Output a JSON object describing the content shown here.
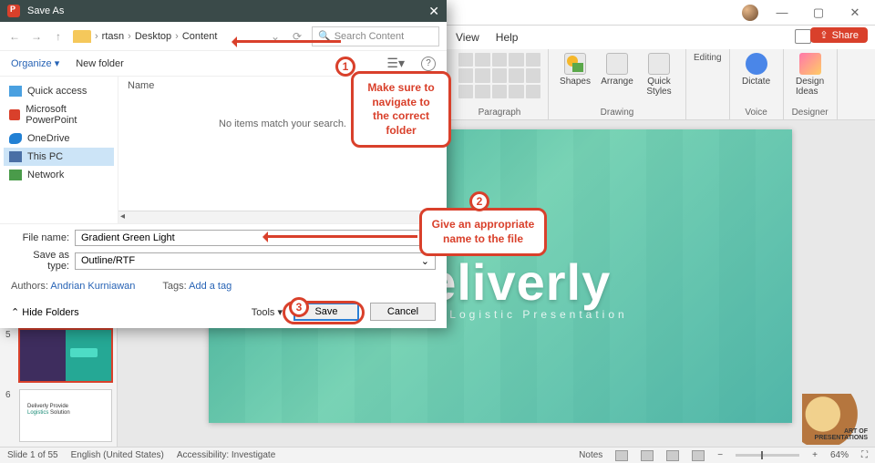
{
  "titlebar": {
    "min": "—",
    "max": "▢",
    "close": "✕"
  },
  "menubar": {
    "view": "View",
    "help": "Help",
    "share": "Share"
  },
  "ribbon": {
    "paragraph": "Paragraph",
    "drawing": "Drawing",
    "shapes": "Shapes",
    "arrange": "Arrange",
    "quick": "Quick",
    "styles": "Styles",
    "editing": "Editing",
    "voice": "Voice",
    "dictate": "Dictate",
    "designer": "Designer",
    "designideas": "Design\nIdeas"
  },
  "thumbs": {
    "n5": "5",
    "n6": "6",
    "t2a": "Deliverly Provide",
    "t2b": "Logistics",
    "t2c": " Solution"
  },
  "slide": {
    "title": "Deliverly",
    "sub": "Creative Logistic Presentation"
  },
  "status": {
    "slide": "Slide 1 of 55",
    "lang": "English (United States)",
    "access": "Accessibility: Investigate",
    "notes": "Notes",
    "zoom": "64%"
  },
  "dialog": {
    "title": "Save As",
    "crumbs": {
      "a": "rtasn",
      "b": "Desktop",
      "c": "Content"
    },
    "search": "Search Content",
    "refresh": "⟳",
    "organize": "Organize",
    "newfolder": "New folder",
    "col_name": "Name",
    "empty": "No items match your search.",
    "tree": {
      "quick": "Quick access",
      "pp": "Microsoft PowerPoint",
      "od": "OneDrive",
      "pc": "This PC",
      "net": "Network"
    },
    "filename_label": "File name:",
    "filename": "Gradient Green Light",
    "savetype_label": "Save as type:",
    "savetype": "Outline/RTF",
    "authors_label": "Authors:",
    "author": "Andrian Kurniawan",
    "tags_label": "Tags:",
    "addtag": "Add a tag",
    "hide": "Hide Folders",
    "tools": "Tools",
    "save": "Save",
    "cancel": "Cancel"
  },
  "ann": {
    "b1": "1",
    "c1": "Make sure to\nnavigate to the\ncorrect folder",
    "b2": "2",
    "c2": "Give an\nappropriate name\nto the file",
    "b3": "3"
  },
  "wm": "ART OF\nPRESENTATIONS"
}
